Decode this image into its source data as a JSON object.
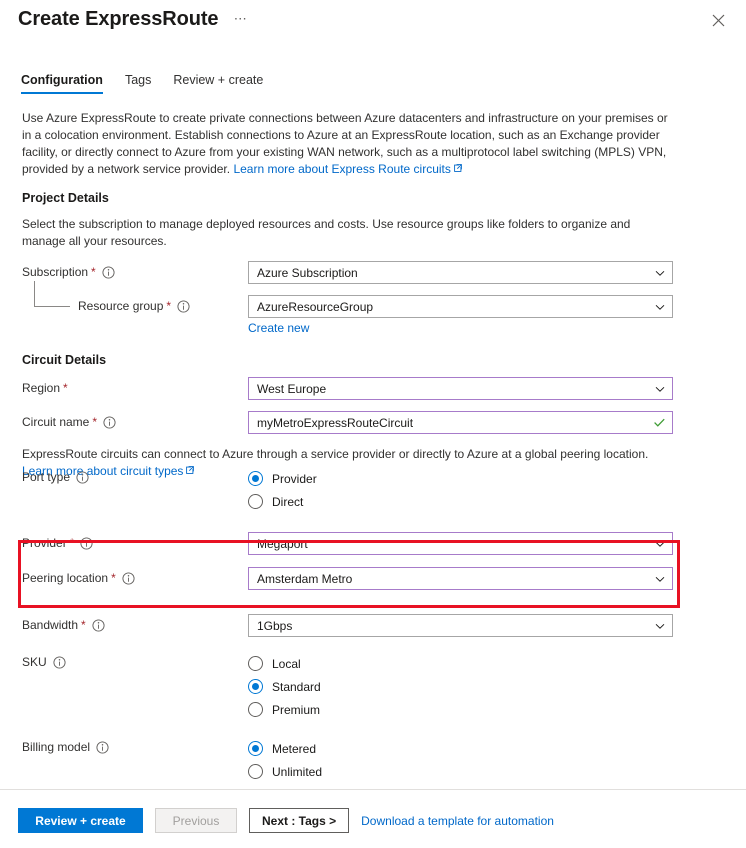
{
  "blade": {
    "title": "Create ExpressRoute",
    "ellipsis": "⋯",
    "close_label": "Close"
  },
  "tabs": [
    {
      "label": "Configuration",
      "active": true
    },
    {
      "label": "Tags",
      "active": false
    },
    {
      "label": "Review + create",
      "active": false
    }
  ],
  "intro": {
    "text": "Use Azure ExpressRoute to create private connections between Azure datacenters and infrastructure on your premises or in a colocation environment. Establish connections to Azure at an ExpressRoute location, such as an Exchange provider facility, or directly connect to Azure from your existing WAN network, such as a multiprotocol label switching (MPLS) VPN, provided by a network service provider. ",
    "link_text": "Learn more about Express Route circuits"
  },
  "project_details": {
    "heading": "Project Details",
    "description": "Select the subscription to manage deployed resources and costs. Use resource groups like folders to organize and manage all your resources.",
    "subscription": {
      "label": "Subscription",
      "required": "*",
      "value": "Azure Subscription"
    },
    "resource_group": {
      "label": "Resource group",
      "required": "*",
      "value": "AzureResourceGroup",
      "create_new": "Create new"
    }
  },
  "circuit_details": {
    "heading": "Circuit Details",
    "region": {
      "label": "Region",
      "required": "*",
      "value": "West Europe"
    },
    "circuit_name": {
      "label": "Circuit name",
      "required": "*",
      "value": "myMetroExpressRouteCircuit"
    },
    "note": "ExpressRoute circuits can connect to Azure through a service provider or directly to Azure at a global peering location.",
    "note_link": "Learn more about circuit types",
    "port_type": {
      "label": "Port type",
      "options": [
        {
          "label": "Provider",
          "selected": true
        },
        {
          "label": "Direct",
          "selected": false
        }
      ]
    },
    "provider": {
      "label": "Provider",
      "required": "*",
      "value": "Megaport"
    },
    "peering_location": {
      "label": "Peering location",
      "required": "*",
      "value": "Amsterdam Metro"
    },
    "bandwidth": {
      "label": "Bandwidth",
      "required": "*",
      "value": "1Gbps"
    },
    "sku": {
      "label": "SKU",
      "options": [
        {
          "label": "Local",
          "selected": false
        },
        {
          "label": "Standard",
          "selected": true
        },
        {
          "label": "Premium",
          "selected": false
        }
      ]
    },
    "billing_model": {
      "label": "Billing model",
      "options": [
        {
          "label": "Metered",
          "selected": true
        },
        {
          "label": "Unlimited",
          "selected": false
        }
      ]
    }
  },
  "footer": {
    "review_create": "Review + create",
    "previous": "Previous",
    "next": "Next : Tags >",
    "download_template": "Download a template for automation"
  },
  "colors": {
    "accent": "#0078d4",
    "link": "#0068c9",
    "required": "#a4262c",
    "highlight": "#e81123",
    "modified_border": "#a77bca",
    "valid_check": "#3f9c35"
  }
}
